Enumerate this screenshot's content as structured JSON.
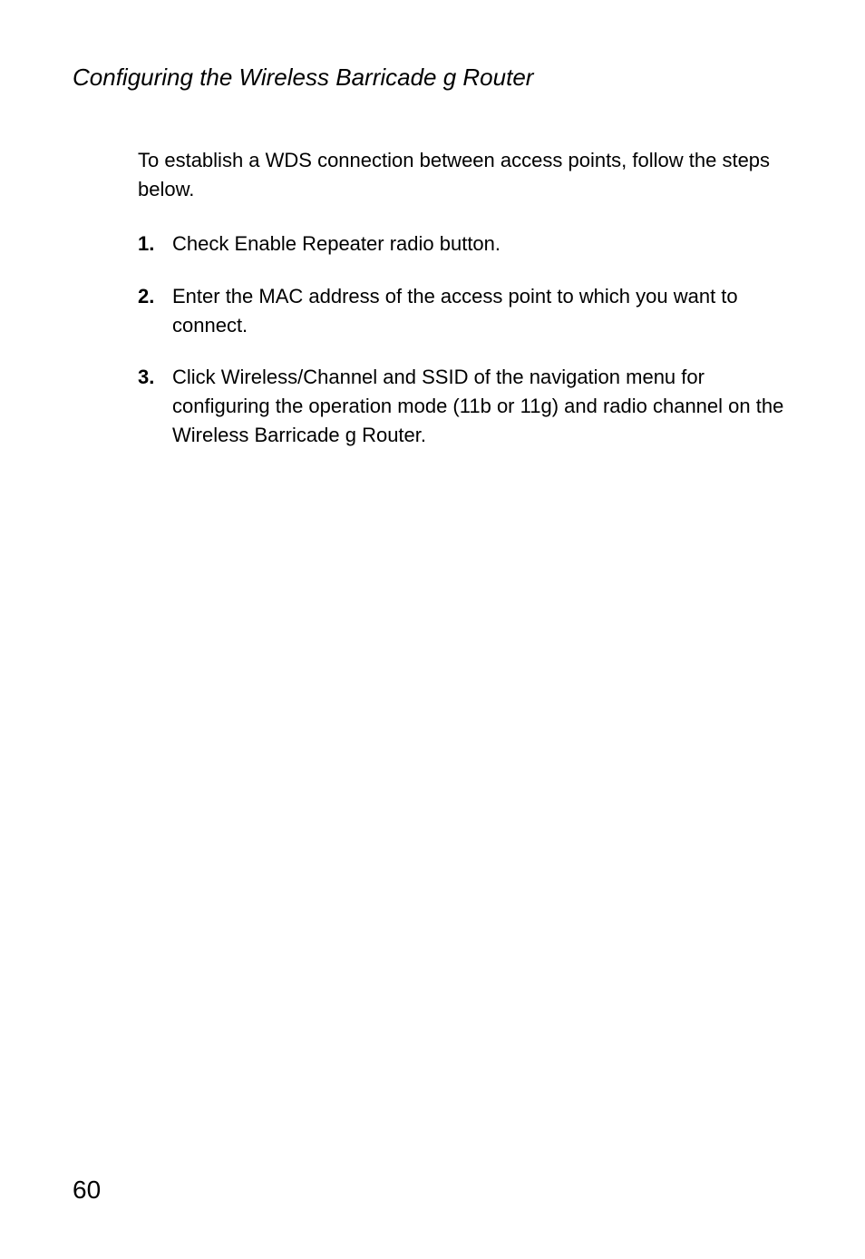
{
  "header": {
    "title": "Configuring the Wireless Barricade g Router"
  },
  "intro": "To establish a WDS connection between access points, follow the steps below.",
  "steps": [
    {
      "number": "1.",
      "text": "Check Enable Repeater radio button."
    },
    {
      "number": "2.",
      "text": "Enter the MAC address of the access point to which you want to connect."
    },
    {
      "number": "3.",
      "text": "Click Wireless/Channel and SSID of the navigation menu for configuring the operation mode (11b or 11g) and radio channel on the Wireless Barricade g Router."
    }
  ],
  "pageNumber": "60"
}
